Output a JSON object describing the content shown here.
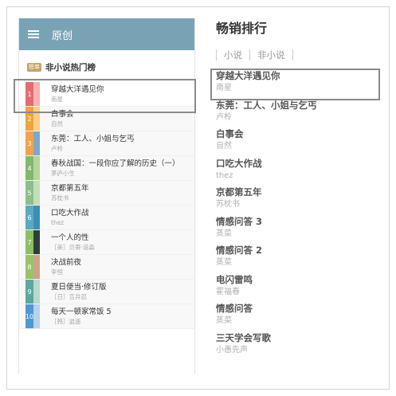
{
  "app_bar": {
    "title": "原创"
  },
  "left_section": {
    "badge": "榜单",
    "title": "非小说热门榜",
    "items": [
      {
        "rank": "1",
        "title": "穿越大洋遇见你",
        "author": "南星",
        "color": "#e86a71",
        "cover": "#f3b4b0"
      },
      {
        "rank": "2",
        "title": "白事会",
        "author": "自然",
        "color": "#f0a43a",
        "cover": "#f7cf8a"
      },
      {
        "rank": "3",
        "title": "东莞：工人、小姐与乞丐",
        "author": "卢柃",
        "color": "#f2a24a",
        "cover": "#7fa8c8"
      },
      {
        "rank": "4",
        "title": "春秋战国：一段你应了解的历史（一）",
        "author": "茅庐小生",
        "color": "#84b86b",
        "cover": "#b7d49b"
      },
      {
        "rank": "5",
        "title": "京都第五年",
        "author": "苏枕书",
        "color": "#8cc08a",
        "cover": "#c5ddb8"
      },
      {
        "rank": "6",
        "title": "口吃大作战",
        "author": "thez",
        "color": "#5aa9c6",
        "cover": "#3d8fb0"
      },
      {
        "rank": "7",
        "title": "一个人的性",
        "author": "［美］贝蒂·道森",
        "color": "#8cbf62",
        "cover": "#2f3e3a"
      },
      {
        "rank": "8",
        "title": "决战前夜",
        "author": "李恒",
        "color": "#9ac26a",
        "cover": "#c9a48a"
      },
      {
        "rank": "9",
        "title": "夏日便当·修订版",
        "author": "［日］吉井忍",
        "color": "#5ca8a0",
        "cover": "#b8d8cf"
      },
      {
        "rank": "10",
        "title": "每天一顿家常饭 5",
        "author": "［韩］逍遥",
        "color": "#4f98d4",
        "cover": "#b7d3ea"
      }
    ]
  },
  "right_section": {
    "title": "畅销排行",
    "tabs": [
      "小说",
      "非小说"
    ],
    "items": [
      {
        "title": "穿越大洋遇见你",
        "author": "南星"
      },
      {
        "title": "东莞：工人、小姐与乞丐",
        "author": "卢柃"
      },
      {
        "title": "白事会",
        "author": "自然"
      },
      {
        "title": "口吃大作战",
        "author": "thez"
      },
      {
        "title": "京都第五年",
        "author": "苏枕书"
      },
      {
        "title": "情感问答 3",
        "author": "蒸菜"
      },
      {
        "title": "情感问答 2",
        "author": "蒸菜"
      },
      {
        "title": "电闪雷鸣",
        "author": "霍福春"
      },
      {
        "title": "情感问答",
        "author": "蒸菜"
      },
      {
        "title": "三天学会写歌",
        "author": "小愚先声"
      }
    ]
  }
}
